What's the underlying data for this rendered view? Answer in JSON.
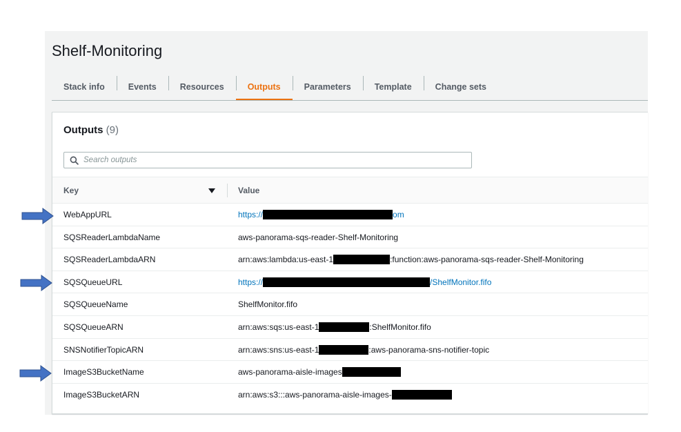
{
  "stack": {
    "name": "Shelf-Monitoring"
  },
  "tabs": [
    {
      "label": "Stack info",
      "active": false
    },
    {
      "label": "Events",
      "active": false
    },
    {
      "label": "Resources",
      "active": false
    },
    {
      "label": "Outputs",
      "active": true
    },
    {
      "label": "Parameters",
      "active": false
    },
    {
      "label": "Template",
      "active": false
    },
    {
      "label": "Change sets",
      "active": false
    }
  ],
  "outputs": {
    "heading": "Outputs",
    "count": "(9)",
    "search_placeholder": "Search outputs",
    "columns": {
      "key": "Key",
      "value": "Value"
    },
    "rows": [
      {
        "key": "WebAppURL",
        "value_prefix": "https://",
        "value_suffix": "om",
        "link": true
      },
      {
        "key": "SQSReaderLambdaName",
        "value_prefix": "aws-panorama-sqs-reader-Shelf-Monitoring",
        "value_suffix": "",
        "link": false
      },
      {
        "key": "SQSReaderLambdaARN",
        "value_prefix": "arn:aws:lambda:us-east-1",
        "value_suffix": ":function:aws-panorama-sqs-reader-Shelf-Monitoring",
        "link": false
      },
      {
        "key": "SQSQueueURL",
        "value_prefix": "https://",
        "value_suffix": "/ShelfMonitor.fifo",
        "link": true
      },
      {
        "key": "SQSQueueName",
        "value_prefix": "ShelfMonitor.fifo",
        "value_suffix": "",
        "link": false
      },
      {
        "key": "SQSQueueARN",
        "value_prefix": "arn:aws:sqs:us-east-1",
        "value_suffix": ":ShelfMonitor.fifo",
        "link": false
      },
      {
        "key": "SNSNotifierTopicARN",
        "value_prefix": "arn:aws:sns:us-east-1",
        "value_suffix": ":aws-panorama-sns-notifier-topic",
        "link": false
      },
      {
        "key": "ImageS3BucketName",
        "value_prefix": "aws-panorama-aisle-images",
        "value_suffix": "",
        "link": false
      },
      {
        "key": "ImageS3BucketARN",
        "value_prefix": "arn:aws:s3:::aws-panorama-aisle-images-",
        "value_suffix": "",
        "link": false
      }
    ]
  },
  "annotations": {
    "arrow_color": "#4472c4",
    "arrow_rows": [
      "WebAppURL",
      "SQSQueueURL",
      "ImageS3BucketName"
    ]
  },
  "colors": {
    "accent": "#ec7211",
    "link": "#0073bb",
    "redaction": "#000000"
  }
}
